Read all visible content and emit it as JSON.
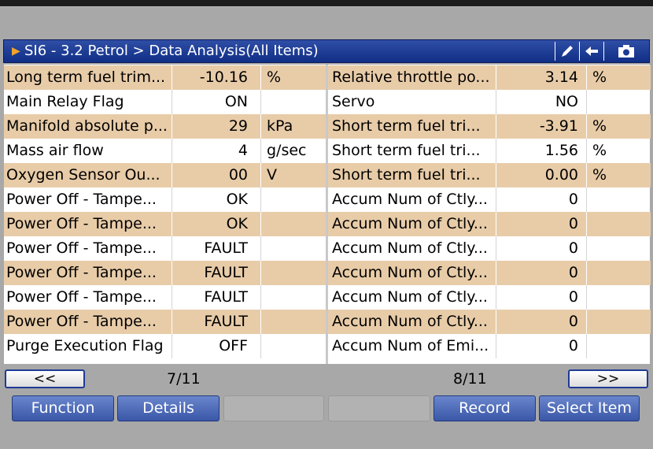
{
  "titlebar": {
    "title": "SI6 - 3.2 Petrol > Data Analysis(All Items)"
  },
  "left_rows": [
    {
      "name": "Long term fuel trim...",
      "value": "-10.16",
      "unit": "%"
    },
    {
      "name": "Main Relay Flag",
      "value": "ON",
      "unit": ""
    },
    {
      "name": "Manifold absolute p...",
      "value": "29",
      "unit": "kPa"
    },
    {
      "name": "Mass air flow",
      "value": "4",
      "unit": "g/sec"
    },
    {
      "name": "Oxygen Sensor Ou...",
      "value": "00",
      "unit": "V"
    },
    {
      "name": "Power Off - Tampe...",
      "value": "OK",
      "unit": ""
    },
    {
      "name": "Power Off - Tampe...",
      "value": "OK",
      "unit": ""
    },
    {
      "name": "Power Off - Tampe...",
      "value": "FAULT",
      "unit": ""
    },
    {
      "name": "Power Off - Tampe...",
      "value": "FAULT",
      "unit": ""
    },
    {
      "name": "Power Off - Tampe...",
      "value": "FAULT",
      "unit": ""
    },
    {
      "name": "Power Off - Tampe...",
      "value": "FAULT",
      "unit": ""
    },
    {
      "name": "Purge Execution Flag",
      "value": "OFF",
      "unit": ""
    }
  ],
  "right_rows": [
    {
      "name": "Relative throttle po...",
      "value": "3.14",
      "unit": "%"
    },
    {
      "name": "Servo",
      "value": "NO",
      "unit": ""
    },
    {
      "name": "Short term fuel tri...",
      "value": "-3.91",
      "unit": "%"
    },
    {
      "name": "Short term fuel tri...",
      "value": "1.56",
      "unit": "%"
    },
    {
      "name": "Short term fuel tri...",
      "value": "0.00",
      "unit": "%"
    },
    {
      "name": "Accum Num of Ctly...",
      "value": "0",
      "unit": ""
    },
    {
      "name": "Accum Num of Ctly...",
      "value": "0",
      "unit": ""
    },
    {
      "name": "Accum Num of Ctly...",
      "value": "0",
      "unit": ""
    },
    {
      "name": "Accum Num of Ctly...",
      "value": "0",
      "unit": ""
    },
    {
      "name": "Accum Num of Ctly...",
      "value": "0",
      "unit": ""
    },
    {
      "name": "Accum Num of Ctly...",
      "value": "0",
      "unit": ""
    },
    {
      "name": "Accum Num of Emi...",
      "value": "0",
      "unit": ""
    }
  ],
  "pager": {
    "prev_label": "<<",
    "next_label": ">>",
    "left_page": "7/11",
    "right_page": "8/11"
  },
  "function_bar": {
    "function": "Function",
    "details": "Details",
    "empty_1": "",
    "empty_2": "",
    "record": "Record",
    "select_item": "Select Item"
  },
  "icons": {
    "title_arrow": "play-triangle-icon",
    "edit": "pen-icon",
    "back": "back-arrow-icon",
    "camera": "camera-icon"
  },
  "colors": {
    "titlebar": "#1a3a94",
    "row_alt": "#e8cca8",
    "button": "#4a68b8",
    "background": "#a8a8a8"
  }
}
